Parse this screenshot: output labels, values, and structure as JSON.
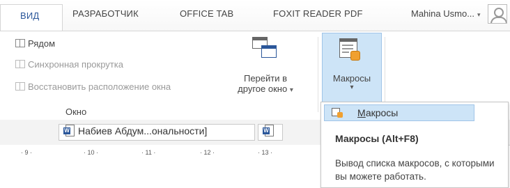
{
  "tabs": [
    {
      "label": "ВИД",
      "active": true
    },
    {
      "label": "РАЗРАБОТЧИК"
    },
    {
      "label": "OFFICE TAB"
    },
    {
      "label": "FOXIT READER PDF"
    }
  ],
  "user": {
    "name": "Mahina Usmo...",
    "dropdown_glyph": "▾"
  },
  "window_group": {
    "commands": [
      {
        "label": "Рядом",
        "icon": "side-by-side-icon",
        "enabled": true
      },
      {
        "label": "Синхронная прокрутка",
        "icon": "sync-scroll-icon",
        "enabled": false
      },
      {
        "label": "Восстановить расположение окна",
        "icon": "reset-window-icon",
        "enabled": false
      }
    ],
    "switch_button": {
      "line1": "Перейти в",
      "line2": "другое окно",
      "arrow": "▾"
    },
    "label": "Окно"
  },
  "macros_group": {
    "button_label": "Макросы",
    "arrow": "▾"
  },
  "collapse_glyph": "^",
  "documents": {
    "tabs": [
      {
        "title": "Набиев Абдум...ональности]"
      },
      {
        "title": ""
      }
    ]
  },
  "ruler": {
    "marks": [
      "· 9 ·",
      "· 10 ·",
      "· 11 ·",
      "· 12 ·",
      "· 13 ·"
    ]
  },
  "dropdown": {
    "item": {
      "label_accel": "М",
      "label_rest": "акросы"
    },
    "tooltip_title": "Макросы (Alt+F8)",
    "tooltip_desc": "Вывод списка макросов, с которыми вы можете работать."
  },
  "colors": {
    "accent": "#2b579a",
    "highlight": "#cde4f7"
  }
}
